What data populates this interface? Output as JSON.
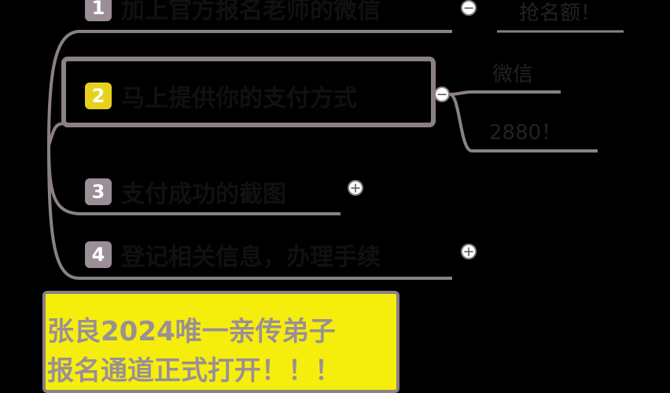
{
  "mindmap": {
    "nodes": [
      {
        "num": "1",
        "label": "加上官方报名老师的微信"
      },
      {
        "num": "2",
        "label": "马上提供你的支付方式"
      },
      {
        "num": "3",
        "label": "支付成功的截图"
      },
      {
        "num": "4",
        "label": "登记相关信息，办理手续"
      }
    ],
    "node1_child": "抢名额！",
    "node2_children": [
      "微信",
      "2880！"
    ],
    "collapse_symbol": "−",
    "expand_symbol": "+"
  },
  "banner": {
    "line1": "张良2024唯一亲传弟子",
    "line2": "报名通道正式打开！！！"
  },
  "colors": {
    "line": "#8a8088",
    "badge": "#9a8f96",
    "badge_selected": "#e6d21e",
    "banner_bg": "#f5ee0d"
  }
}
